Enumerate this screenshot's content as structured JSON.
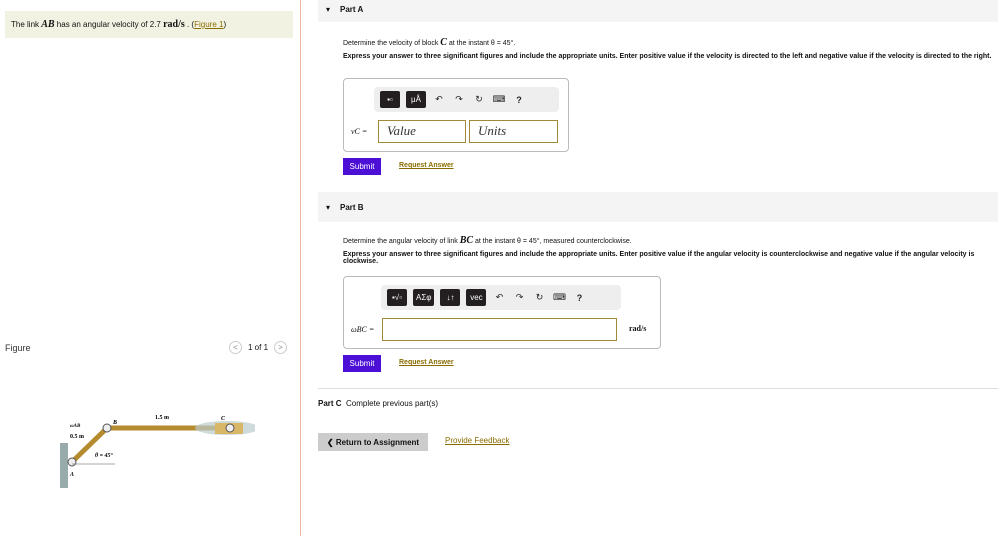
{
  "intro": {
    "pre": "The link ",
    "link_var": "AB",
    "mid": " has an angular velocity of 2.7 ",
    "unit": "rad/s",
    "post": " . (",
    "figure_link": "Figure 1",
    "close": ")"
  },
  "figure": {
    "header": "Figure",
    "pager": "1 of 1",
    "prev": "<",
    "next": ">",
    "labels": {
      "bc_length": "1.5 m",
      "ab_length": "0.5 m",
      "omega": "ωAB",
      "theta": "θ = 45°",
      "A": "A",
      "B": "B",
      "C": "C"
    }
  },
  "partA": {
    "title": "Part A",
    "question_pre": "Determine the velocity of block ",
    "var": "C",
    "question_post": " at the instant θ = 45°.",
    "instructions": "Express your answer to three significant figures and include the appropriate units. Enter positive value if the velocity is directed to the left and negative value if the velocity is directed to the right.",
    "toolbar": [
      "▪▫",
      "μÅ"
    ],
    "label": "vC =",
    "value_placeholder": "Value",
    "units_placeholder": "Units",
    "submit": "Submit",
    "request": "Request Answer"
  },
  "partB": {
    "title": "Part B",
    "question_pre": "Determine the angular velocity of link ",
    "var": "BC",
    "question_post": " at the instant θ = 45°, measured counterclockwise.",
    "instructions": "Express your answer to three significant figures and include the appropriate units. Enter positive value if the angular velocity is counterclockwise and negative value if the angular velocity is clockwise.",
    "toolbar": [
      "▪√▫",
      "ΑΣφ",
      "↓↑",
      "vec"
    ],
    "label": "ωBC =",
    "unit": "rad/s",
    "submit": "Submit",
    "request": "Request Answer"
  },
  "partC": {
    "title": "Part C",
    "text": "Complete previous part(s)"
  },
  "footer": {
    "return": "❮ Return to Assignment",
    "feedback": "Provide Feedback"
  },
  "icons": {
    "undo": "↶",
    "redo": "↷",
    "reset": "↻",
    "keyboard": "⌨",
    "help": "?"
  }
}
